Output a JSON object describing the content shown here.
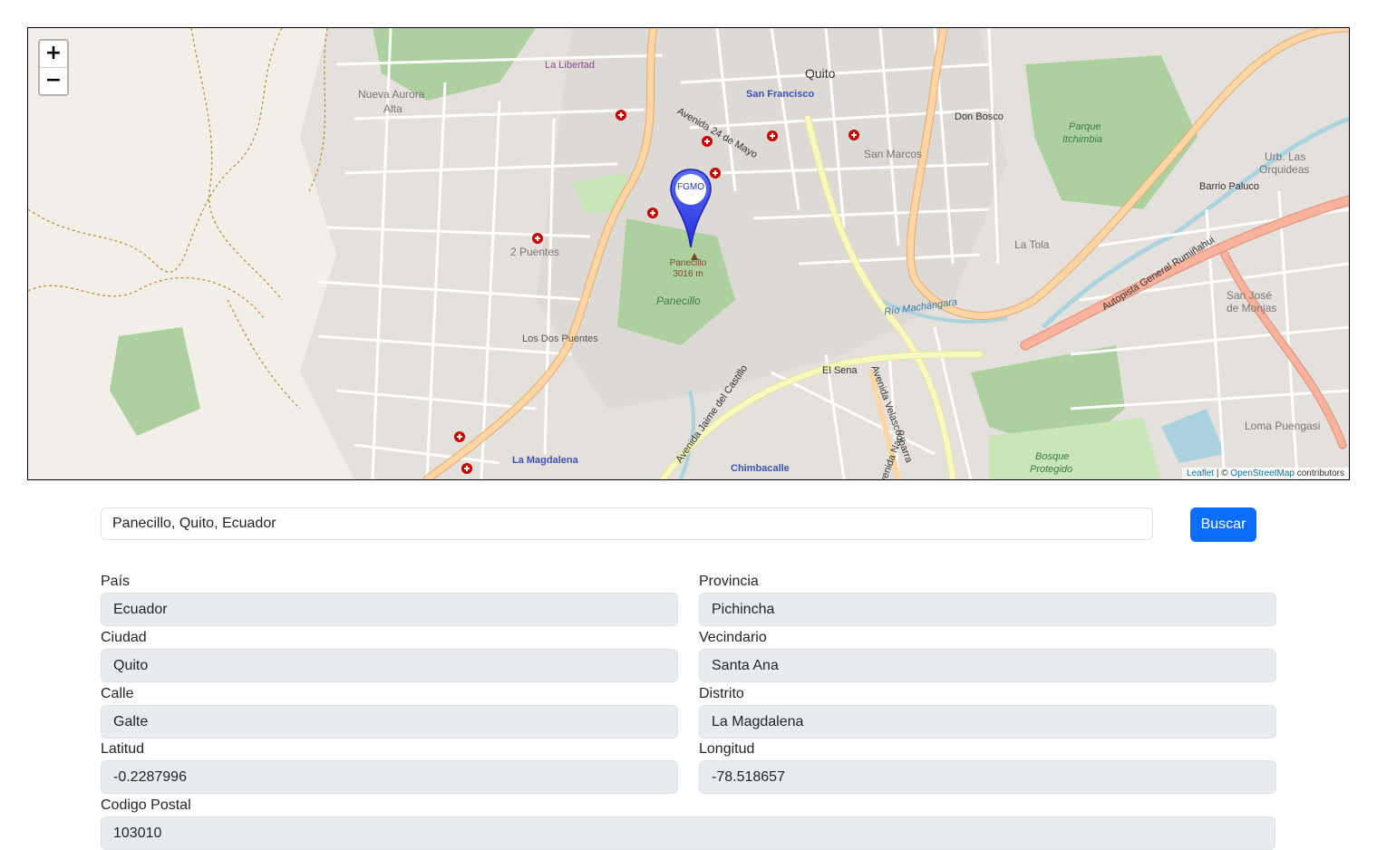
{
  "map": {
    "zoom_in": "+",
    "zoom_out": "−",
    "attribution": {
      "leaflet": "Leaflet",
      "sep": " | © ",
      "osm": "OpenStreetMap",
      "suffix": " contributors"
    },
    "marker_text": "FGMO",
    "peak_name": "Panecillo",
    "peak_elev": "3016 m",
    "labels": {
      "quito": "Quito",
      "san_francisco": "San Francisco",
      "la_magdalena": "La Magdalena",
      "chimbacalle": "Chimbacalle",
      "san_marcos": "San Marcos",
      "nueva_aurora": "Nueva Aurora",
      "alta": "Alta",
      "dos_puentes": "2 Puentes",
      "los_dos_puentes": "Los Dos Puentes",
      "parque": "Parque",
      "itchimbia": "Itchimbia",
      "bosque": "Bosque",
      "protegido": "Protegido",
      "don_bosco": "Don Bosco",
      "la_tola": "La Tola",
      "barrio_paluco": "Barrio Paluco",
      "urb_las": "Urb. Las",
      "orquideas": "Orquideas",
      "loma_puengasi": "Loma Puengasi",
      "san_jose": "San José",
      "de_monjas": "de Monjas",
      "la_libertad": "La Libertad",
      "panecillo_hill": "Panecillo",
      "rio_machangara": "Río Machángara",
      "autopista": "Autopista General Rumiñahui",
      "el_sena": "El Sena",
      "av_24_mayo": "Avenida 24 de Mayo",
      "av_velasco": "Avenida Velasco Ibarra",
      "av_napo": "Avenida Napo",
      "av_jaime": "Avenida Jaime del Castillo"
    }
  },
  "search": {
    "value": "Panecillo, Quito, Ecuador",
    "button": "Buscar"
  },
  "fields": {
    "pais": {
      "label": "País",
      "value": "Ecuador"
    },
    "provincia": {
      "label": "Provincia",
      "value": "Pichincha"
    },
    "ciudad": {
      "label": "Ciudad",
      "value": "Quito"
    },
    "vecindario": {
      "label": "Vecindario",
      "value": "Santa Ana"
    },
    "calle": {
      "label": "Calle",
      "value": "Galte"
    },
    "distrito": {
      "label": "Distrito",
      "value": "La Magdalena"
    },
    "latitud": {
      "label": "Latitud",
      "value": "-0.2287996"
    },
    "longitud": {
      "label": "Longitud",
      "value": "-78.518657"
    },
    "codigo_postal": {
      "label": "Codigo Postal",
      "value": "103010"
    }
  },
  "colors": {
    "primary": "#0d6efd",
    "map_bg": "#f2efe9",
    "park": "#add19e",
    "major_road": "#fcd6a4",
    "trunk_road": "#f9b29c",
    "river": "#aad3df",
    "marker": "#3340f5"
  }
}
